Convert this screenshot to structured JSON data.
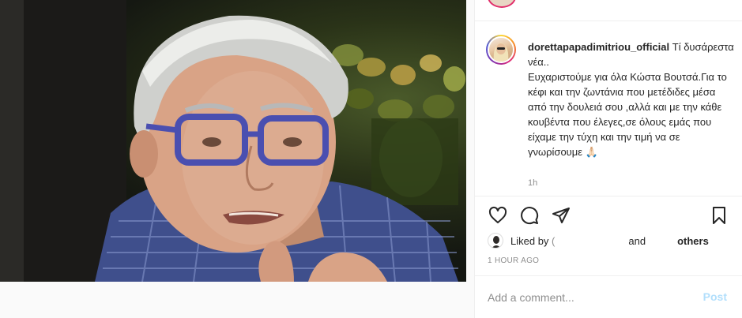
{
  "post": {
    "username": "dorettapapadimitriou_official",
    "caption": " Τί δυσάρεστα νέα..\nΕυχαριστούμε για όλα Κώστα Βουτσά.Για το κέφι και την ζωντάνια που μετέδιδες μέσα από την δουλειά σου ,αλλά και με την κάθε κουβέντα που έλεγες,σε όλους εμάς που είχαμε την τύχη και την τιμή να σε γνωρίσουμε 🙏🏻",
    "caption_age": "1h",
    "likes_prefix": "Liked by ",
    "likes_first": "(",
    "likes_and": "and",
    "likes_others": "others",
    "timestamp": "1 HOUR AGO"
  },
  "actions": {
    "like_icon": "heart-icon",
    "comment_icon": "comment-icon",
    "share_icon": "send-icon",
    "save_icon": "bookmark-icon"
  },
  "comment": {
    "placeholder": "Add a comment...",
    "post_label": "Post"
  },
  "colors": {
    "post_button": "#b2dffc",
    "muted_text": "#8e8e8e",
    "glasses": "#4a4fb0"
  }
}
